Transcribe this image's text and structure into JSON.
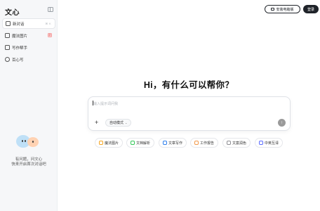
{
  "app": {
    "logo": "文心",
    "collapse_icon": "sidebar-toggle-icon"
  },
  "sidebar": {
    "items": [
      {
        "label": "新对话",
        "icon": "new-chat-icon",
        "shortcut": "⌘ K",
        "active": true
      },
      {
        "label": "魔法图片",
        "icon": "image-icon",
        "badge": "新"
      },
      {
        "label": "写作帮手",
        "icon": "pen-icon"
      },
      {
        "label": "百心写",
        "icon": "sparkle-icon"
      }
    ],
    "promo": {
      "line1": "有问题，问文心",
      "line2": "快来开启首次对话吧"
    }
  },
  "header": {
    "install_label": "安装电脑版",
    "login_label": "登录"
  },
  "main": {
    "greeting": "Hi，有什么可以帮你？",
    "input": {
      "placeholder": "输入提示词问我",
      "mode_label": "自动模式",
      "send_icon": "arrow-up-icon"
    },
    "quick_actions": [
      {
        "label": "魔法图片",
        "color": "#f5a623"
      },
      {
        "label": "文档解析",
        "color": "#34c759"
      },
      {
        "label": "文章写作",
        "color": "#2f80ed"
      },
      {
        "label": "工作报告",
        "color": "#f2994a"
      },
      {
        "label": "文案润色",
        "color": "#8e8e93"
      },
      {
        "label": "中英互译",
        "color": "#5b6cff"
      }
    ]
  }
}
